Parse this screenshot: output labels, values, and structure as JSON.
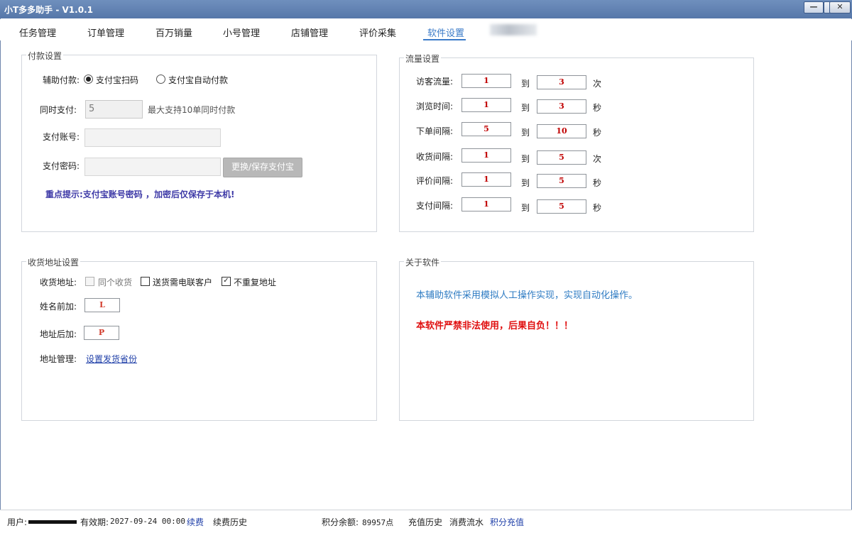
{
  "window": {
    "title": "小T多多助手 - V1.0.1"
  },
  "tabs": [
    {
      "label": "任务管理"
    },
    {
      "label": "订单管理"
    },
    {
      "label": "百万销量"
    },
    {
      "label": "小号管理"
    },
    {
      "label": "店铺管理"
    },
    {
      "label": "评价采集"
    },
    {
      "label": "软件设置"
    }
  ],
  "payment": {
    "legend": "付款设置",
    "assist_label": "辅助付款:",
    "radio_scan": "支付宝扫码",
    "radio_auto": "支付宝自动付款",
    "concurrent_label": "同时支付:",
    "concurrent_value": "5",
    "concurrent_hint": "最大支持10单同时付款",
    "account_label": "支付账号:",
    "password_label": "支付密码:",
    "save_button": "更换/保存支付宝",
    "warning": "重点提示:支付宝账号密码 ，加密后仅保存于本机!"
  },
  "traffic": {
    "legend": "流量设置",
    "to": "到",
    "rows": [
      {
        "label": "访客流量:",
        "min": "1",
        "max": "3",
        "unit": "次"
      },
      {
        "label": "浏览时间:",
        "min": "1",
        "max": "3",
        "unit": "秒"
      },
      {
        "label": "下单间隔:",
        "min": "5",
        "max": "10",
        "unit": "秒"
      },
      {
        "label": "收货间隔:",
        "min": "1",
        "max": "5",
        "unit": "次"
      },
      {
        "label": "评价间隔:",
        "min": "1",
        "max": "5",
        "unit": "秒"
      },
      {
        "label": "支付间隔:",
        "min": "1",
        "max": "5",
        "unit": "秒"
      }
    ]
  },
  "address": {
    "legend": "收货地址设置",
    "address_label": "收货地址:",
    "opt_same": "同个收货",
    "opt_contact": "送货需电联客户",
    "opt_norepeat": "不重复地址",
    "name_prefix_label": "姓名前加:",
    "name_prefix_value": "L",
    "addr_suffix_label": "地址后加:",
    "addr_suffix_value": "P",
    "manage_label": "地址管理:",
    "manage_link": "设置发货省份"
  },
  "about": {
    "legend": "关于软件",
    "line1": "本辅助软件采用模拟人工操作实现，实现自动化操作。",
    "line2": "本软件严禁非法使用，后果自负！！！"
  },
  "status": {
    "user_label": "用户:",
    "validity_label": "有效期:",
    "validity_value": "2027-09-24 00:00",
    "renew": "续费",
    "renew_history": "续费历史",
    "points_label": "积分余额:",
    "points_value": "89957点",
    "recharge_history": "充值历史",
    "consume_flow": "消费流水",
    "points_recharge": "积分充值"
  }
}
